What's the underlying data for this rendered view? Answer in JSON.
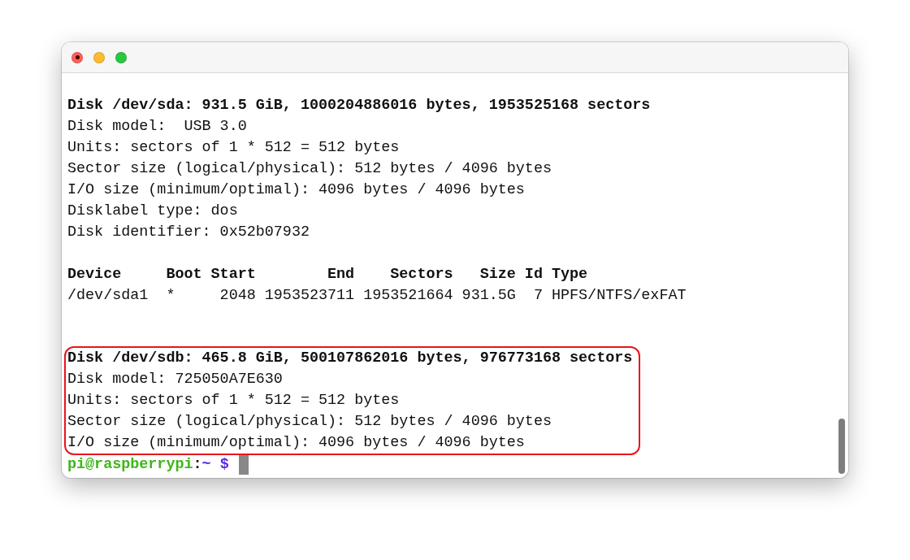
{
  "window": {
    "controls": [
      {
        "kind": "close"
      },
      {
        "kind": "minimize"
      },
      {
        "kind": "zoom"
      }
    ]
  },
  "sections": [
    {
      "highlighted": false,
      "lines": [
        {
          "kind": "bold",
          "text": "Disk /dev/sda: 931.5 GiB, 1000204886016 bytes, 1953525168 sectors"
        },
        {
          "kind": "text",
          "text": "Disk model:  USB 3.0"
        },
        {
          "kind": "text",
          "text": "Units: sectors of 1 * 512 = 512 bytes"
        },
        {
          "kind": "text",
          "text": "Sector size (logical/physical): 512 bytes / 4096 bytes"
        },
        {
          "kind": "text",
          "text": "I/O size (minimum/optimal): 4096 bytes / 4096 bytes"
        },
        {
          "kind": "text",
          "text": "Disklabel type: dos"
        },
        {
          "kind": "text",
          "text": "Disk identifier: 0x52b07932"
        },
        {
          "kind": "blank"
        },
        {
          "kind": "bold",
          "text": "Device     Boot Start        End    Sectors   Size Id Type"
        },
        {
          "kind": "text",
          "text": "/dev/sda1  *     2048 1953523711 1953521664 931.5G  7 HPFS/NTFS/exFAT"
        },
        {
          "kind": "blank"
        },
        {
          "kind": "blank"
        }
      ]
    },
    {
      "highlighted": true,
      "lines": [
        {
          "kind": "bold",
          "text": "Disk /dev/sdb: 465.8 GiB, 500107862016 bytes, 976773168 sectors"
        },
        {
          "kind": "text",
          "text": "Disk model: 725050A7E630"
        },
        {
          "kind": "text",
          "text": "Units: sectors of 1 * 512 = 512 bytes"
        },
        {
          "kind": "text",
          "text": "Sector size (logical/physical): 512 bytes / 4096 bytes"
        },
        {
          "kind": "text",
          "text": "I/O size (minimum/optimal): 4096 bytes / 4096 bytes"
        }
      ]
    }
  ],
  "prompt": {
    "user_host": "pi@raspberrypi",
    "separator": ":",
    "path": "~",
    "symbol": "$"
  }
}
